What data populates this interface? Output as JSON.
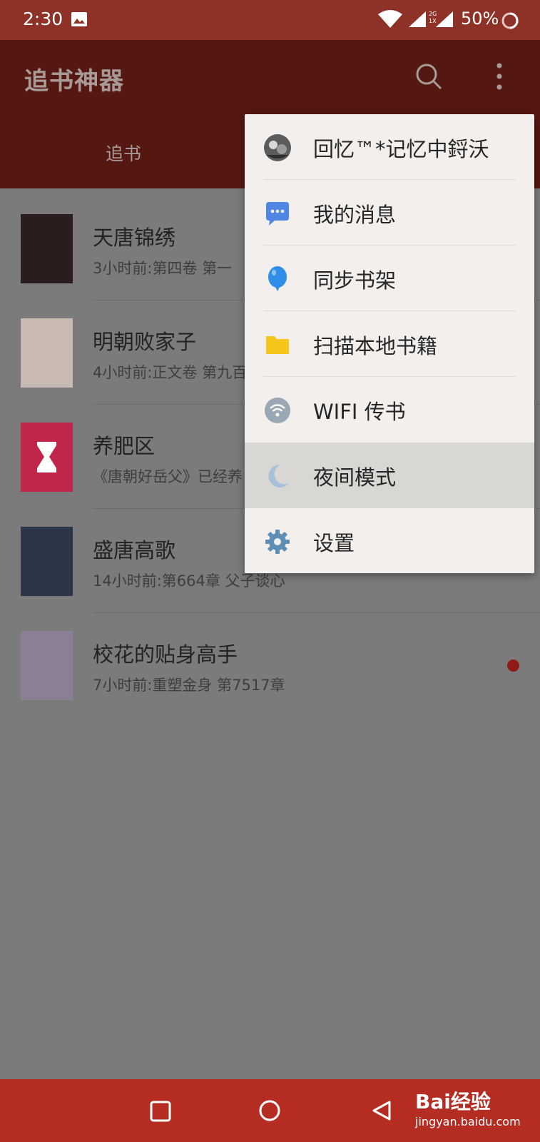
{
  "status_bar": {
    "time": "2:30",
    "network_label_top": "2G",
    "network_label_bottom": "1X",
    "battery": "50%"
  },
  "app_bar": {
    "title": "追书神器",
    "tab": "追书"
  },
  "books": [
    {
      "title": "天唐锦绣",
      "subtitle": "3小时前:第四卷 第一",
      "cover_color": "#2b1d1e",
      "unread": false
    },
    {
      "title": "明朝败家子",
      "subtitle": "4小时前:正文卷 第九百",
      "cover_color": "#c9b9b3",
      "unread": false
    },
    {
      "title": "养肥区",
      "subtitle": "《唐朝好岳父》已经养",
      "cover_color": "#c2254a",
      "unread": false
    },
    {
      "title": "盛唐高歌",
      "subtitle": "14小时前:第664章 父子谈心",
      "cover_color": "#2d3648",
      "unread": false
    },
    {
      "title": "校花的贴身高手",
      "subtitle": "7小时前:重塑金身 第7517章",
      "cover_color": "#8a7f95",
      "unread": true
    }
  ],
  "menu": {
    "items": [
      {
        "label": "回忆™*记忆中鋝沃",
        "icon": "avatar"
      },
      {
        "label": "我的消息",
        "icon": "message-icon"
      },
      {
        "label": "同步书架",
        "icon": "sync-icon"
      },
      {
        "label": "扫描本地书籍",
        "icon": "folder-icon"
      },
      {
        "label": "WIFI 传书",
        "icon": "wifi-icon"
      },
      {
        "label": "夜间模式",
        "icon": "moon-icon"
      },
      {
        "label": "设置",
        "icon": "gear-icon"
      }
    ],
    "active_index": 5
  },
  "watermark": {
    "brand": "Bai经验",
    "url": "jingyan.baidu.com"
  },
  "colors": {
    "status_bar": "#8e3126",
    "app_bar": "#551711",
    "nav_bar": "#b42c22",
    "menu_bg": "#f3efec"
  }
}
